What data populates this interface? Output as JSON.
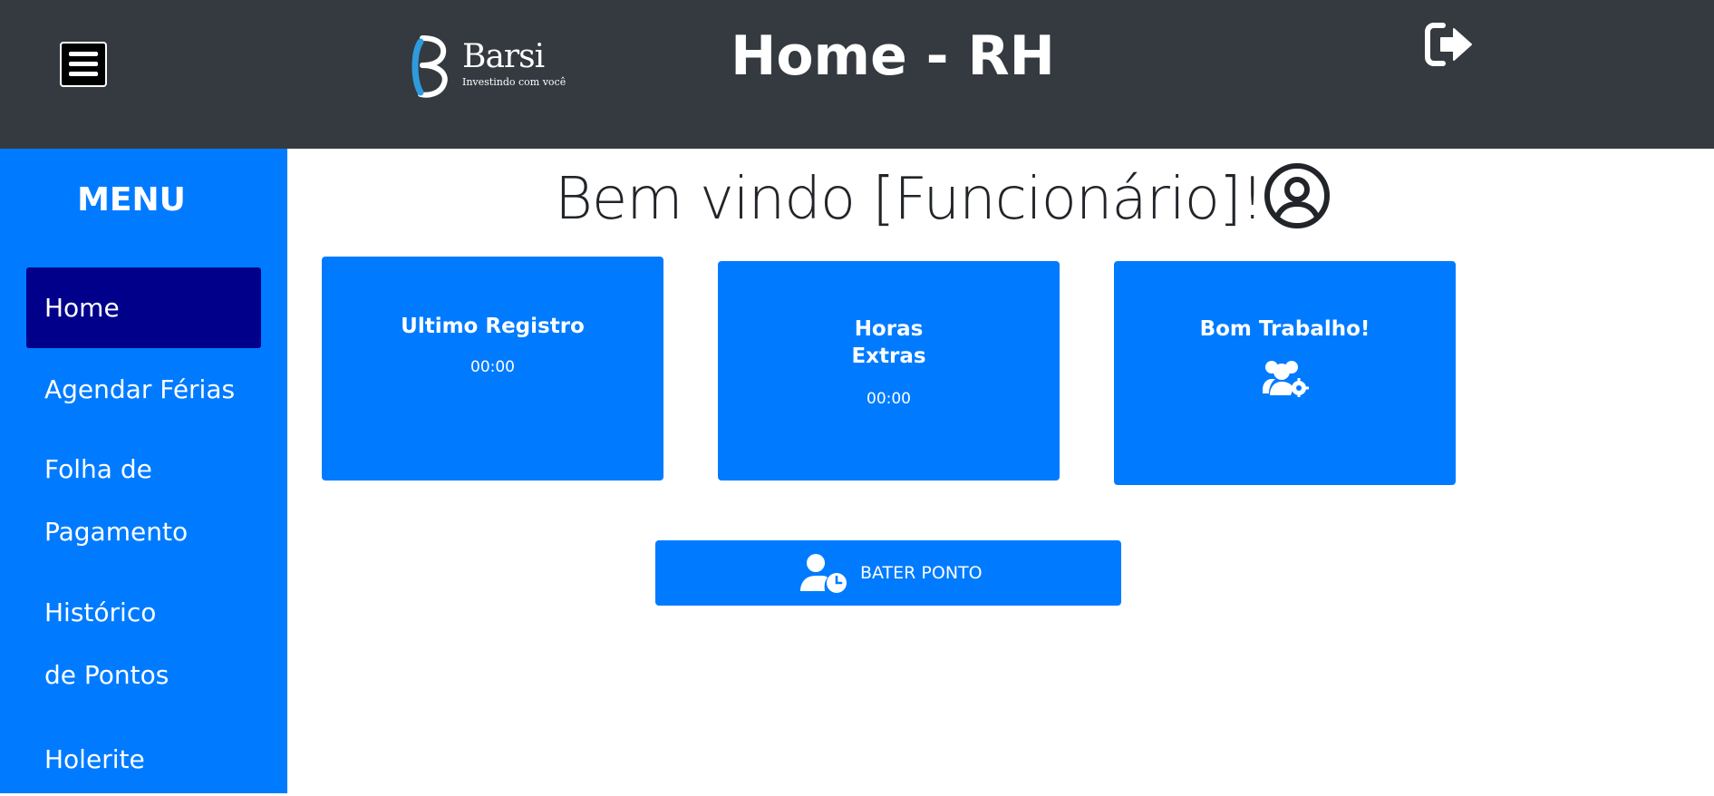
{
  "header": {
    "title": "Home - RH",
    "logo_brand": "Barsi",
    "logo_tagline": "Investindo com você",
    "menu_icon": "hamburger-icon",
    "logout_icon": "sign-out-icon"
  },
  "sidebar": {
    "title": "MENU",
    "items": [
      {
        "label": "Home",
        "active": true
      },
      {
        "label": "Agendar Férias"
      },
      {
        "line1": "Folha de",
        "line2": "Pagamento"
      },
      {
        "line1": "Histórico",
        "line2": "de Pontos"
      },
      {
        "label": "Holerite"
      }
    ]
  },
  "main": {
    "welcome": "Bem vindo [Funcionário]!",
    "welcome_icon": "user-circle-icon",
    "cards": [
      {
        "title": "Ultimo Registro",
        "value": "00:00"
      },
      {
        "title_line1": "Horas",
        "title_line2": "Extras",
        "value": "00:00"
      },
      {
        "title": "Bom Trabalho!",
        "icon": "users-cog-icon"
      }
    ],
    "bater_ponto": {
      "label": "BATER PONTO",
      "icon": "user-clock-icon"
    }
  },
  "colors": {
    "header_bg": "#343a40",
    "sidebar_bg": "#007bff",
    "active_item_bg": "#00008b",
    "card_bg": "#007bff",
    "text_dark": "#212529"
  }
}
